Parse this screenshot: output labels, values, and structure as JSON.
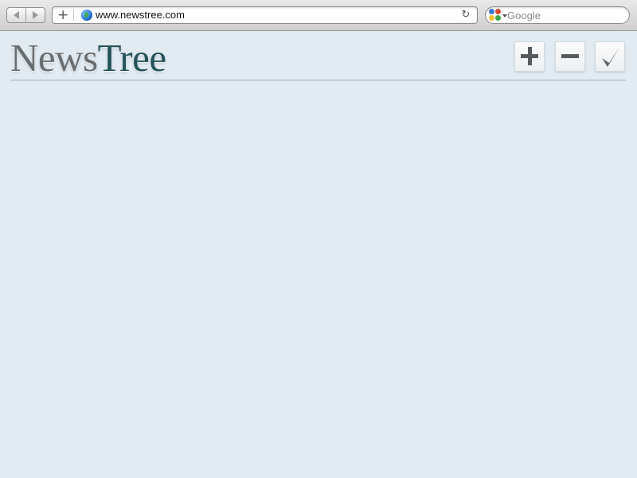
{
  "browser": {
    "url": "www.newstree.com",
    "search_placeholder": "Google",
    "icons": {
      "back": "back-arrow-icon",
      "forward": "forward-arrow-icon",
      "add_bookmark": "plus-icon",
      "site": "globe-icon",
      "reload": "reload-icon",
      "search_engine": "google-icon"
    },
    "reload_glyph": "↻",
    "add_bookmark_glyph": "+"
  },
  "page": {
    "brand_first": "News",
    "brand_second": "Tree",
    "colors": {
      "background": "#e1ebf1",
      "brand_first": "#6b6e70",
      "brand_second": "#23535b"
    },
    "actions": {
      "add": "plus-icon",
      "remove": "minus-icon",
      "done": "checkmark-icon"
    }
  }
}
